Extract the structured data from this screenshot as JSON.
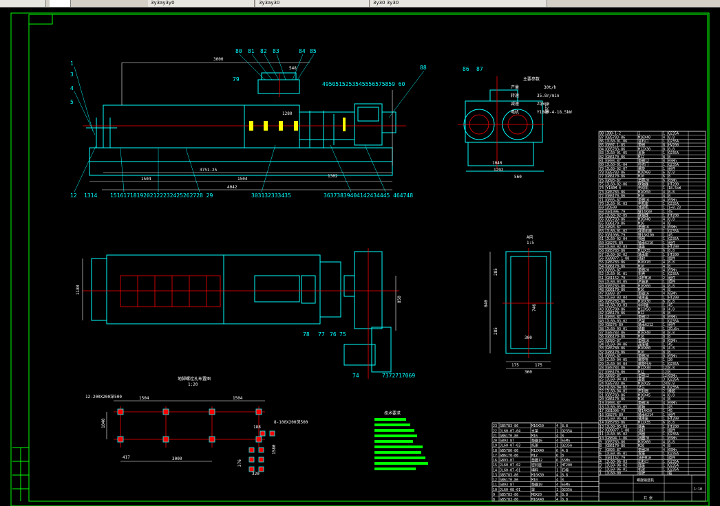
{
  "tabs": [
    {
      "label": "",
      "name": "tab-1"
    },
    {
      "label": "3y3ay3y0",
      "name": "tab-2"
    },
    {
      "label": "3y3ay30",
      "name": "tab-3"
    },
    {
      "label": "3y30 3y30",
      "name": "tab-4"
    },
    {
      "label": "",
      "name": "tab-5"
    }
  ],
  "colors": {
    "background": "#000000",
    "frame": "#00ff00",
    "machine": "#00ffff",
    "centerline": "#ff0000",
    "annotation": "#ffffff",
    "notes": "#00ff00"
  },
  "front_view": {
    "dims": {
      "overall_top": "3000",
      "d548": "548",
      "d3751": "3751.25",
      "d1504a": "1504",
      "d1504b": "1504",
      "d4042": "4042",
      "d1302": "1302",
      "d1280": "1280"
    },
    "callouts_top": [
      "80",
      "81",
      "82",
      "83",
      "84",
      "85",
      "79",
      "88",
      "86",
      "87"
    ],
    "callouts_mid": "4950515253545556575859 60",
    "callouts_left": [
      "1",
      "3",
      "4",
      "5"
    ],
    "callouts_bottom": [
      "12",
      "1314",
      "1516171819202122232425262728 29",
      "303132333435",
      "36373839404142434445 464748"
    ]
  },
  "side_view": {
    "params_title": "主要参数",
    "params": [
      {
        "k": "产量",
        "v": "30t/h"
      },
      {
        "k": "转速",
        "v": "35.8r/min"
      },
      {
        "k": "减速",
        "v": "ZQ500"
      },
      {
        "k": "电机",
        "v": "Y180M-4-18.5kW"
      }
    ],
    "dims": {
      "width1": "1040",
      "width2": "1292",
      "width3": "560"
    }
  },
  "top_view": {
    "callouts": [
      "78",
      "77",
      "76",
      "75",
      "74",
      "7372717069"
    ],
    "dims": {
      "left": "1180",
      "right": "850"
    }
  },
  "section_view": {
    "title": "A向",
    "scale": "1:5",
    "dims": {
      "h_top": "285",
      "h_total": "840",
      "h_bottom": "285",
      "inner": "746",
      "w_inner": "300",
      "w_left": "175",
      "w_right": "175",
      "w_total": "360"
    }
  },
  "foundation": {
    "title": "地脚螺栓孔布置图",
    "scale": "1:20",
    "bolt_label": "12-200X200深500",
    "bolt_label2": "8-100X200深500",
    "dims": {
      "a": "1504",
      "b": "1504",
      "c": "1040",
      "d": "3000",
      "e": "417",
      "f": "188",
      "g": "376",
      "h": "1580",
      "i": "320"
    }
  },
  "notes": {
    "title": "技术要求"
  },
  "parts_table": {
    "rows": [
      "88|JB8-1-2|1|1|Q235A",
      "87|GB5783-86|M16X40|4|8.8",
      "86|JL60-01-06|进料口|1|Q235A",
      "85|GB97.1-85|垫圈|8|HV200",
      "84|GB5783-86|M12X30|8|8.8",
      "83|JL60-01-05|盖板|1|Q235A",
      "82|GB6170-86|M12|8|8",
      "81|GB93-87|垫圈12|8|65Mn",
      "80|JL60-01-04|检修门|1|Q235A",
      "79|JL60-02-07|螺旋|1|组件",
      "78|GB5783-86|M20X60|6|8.8",
      "77|GB6170-86|M20|6|8",
      "76|GB93-87|垫圈20|6|65Mn",
      "75|JL60-02-06|联轴器|1|HT200",
      "74|Y180M-4|电动机|1|18.5kW",
      "73|GB5783-86|M16X50|4|8.8",
      "72|GB6170-86|M16|4|8",
      "71|GB93-87|垫圈16|4|65Mn",
      "70|JL60-01-03|电机座|1|Q235A",
      "69|ZQ500|减速机|1|i=8.23",
      "68|GB1096-79|键14X80|1|45",
      "67|JL60-02-05|联轴器|1|HT200",
      "66|GB5783-86|M16X40|4|8.8",
      "65|GB6170-86|M16|4|8",
      "64|GB93-87|垫圈16|4|65Mn",
      "63|JL60-01-02|减速机座|1|Q235A",
      "62|GB1096-79|键18X100|1|45",
      "61|JL60-02-04|挡圈|1|Q235A",
      "60|GB276-89|轴承6216|1|组件",
      "59|JL60-02-03|端盖|1|HT200",
      "58|GB5783-86|M12X35|6|8.8",
      "57|JL60-02-02|轴承座|1|HT200",
      "56|GB9877.1-88|油封|1|组件",
      "55|GB5783-86|M20X70|4|8.8",
      "54|GB6170-86|M20|4|8",
      "53|GB93-87|垫圈20|4|65Mn",
      "52|JL60-01-01|机壳|1|Q235A",
      "51|GB1152-79|油杯M10|2|组件",
      "50|JL60-03-05|吊轴承|1|组件",
      "49|GB5783-86|M16X60|4|8.8",
      "48|GB6170-86|M16|4|8",
      "47|GB93-87|垫圈16|4|65Mn",
      "46|JL60-03-04|轴承盖|1|HT200",
      "45|GB5783-86|M10X30|6|8.8",
      "44|JL60-03-03|中间轴|1|45",
      "43|GB5780-86|M12X50|8|4.8",
      "42|GB6170-86|M12|8|8",
      "41|GB93-87|垫圈12|8|65Mn",
      "40|JL60-03-02|吊架|1|Q235A",
      "39|GB276-89|轴承6212|1|组件",
      "38|JL60-03-01|轴套|1|ZCuSn",
      "37|GB5783-86|M16X40|8|8.8",
      "36|GB6170-86|M16|8|8",
      "35|GB93-87|垫圈16|8|65Mn",
      "34|JL60-04-06|连接轴|1|45",
      "33|GB5780-86|M20X80|8|4.8",
      "32|GB6170-86|M20|8|8",
      "31|GB93-87|垫圈20|8|65Mn",
      "30|JL60-04-05|螺旋管|1|20",
      "29|JL60-04-04|螺旋叶片|1|Q235A",
      "28|GB5783-86|M12X30|12|8.8",
      "27|GB6170-86|M12|12|8",
      "26|GB93-87|垫圈12|12|65Mn",
      "25|JL60-04-03|盖板|3|Q235A",
      "24|GB5783-86|M10X25|24|8.8",
      "23|JL60-04-02|法兰|4|Q235A",
      "22|JL60-04-01|密封圈|2|橡胶",
      "21|GB5783-86|M16X45|4|8.8",
      "20|GB6170-86|M16|4|8",
      "19|GB93-87|垫圈16|4|65Mn",
      "18|JL60-05-05|尾轴|1|45",
      "17|GB1096-79|键14X50|1|45",
      "16|GB276-89|轴承6214|1|组件",
      "15|JL60-05-04|轴承座|1|HT200",
      "14|GB5783-86|M12X35|6|8.8",
      "13|JL60-05-03|端盖|1|HT200",
      "12|GB9877.1-88|油封|1|组件",
      "11|JL60-05-02|挡圈|1|Q235A",
      "10|GB894.1-86|挡圈70|1|65Mn",
      "9|GB5783-86|M20X60|4|8.8",
      "8|GB6170-86|M20|4|8",
      "7|GB93-87|垫圈20|4|65Mn",
      "6|JL60-05-01|支座|1|Q235A",
      "5|GB1152-79|油杯M10|1|组件",
      "4|JL60-06-03|出料口|1|Q235A",
      "3|JL60-06-02|底座|1|Q235A",
      "2|JL60-06-01|机架|1|Q235A",
      "1|JL60-00|标牌|1|铝"
    ],
    "bottom_rows": [
      "23|GB5783-86|M16X50|4|8.8",
      "22|JL60-07-04|支架|1|Q235A",
      "21|GB6170-86|M16|4|8",
      "20|GB93-87|垫圈16|4|65Mn",
      "19|JL60-07-03|托架|1|Q235A",
      "18|GB5780-86|M12X40|6|4.8",
      "17|GB6170-86|M12|6|8",
      "16|GB93-87|垫圈12|6|65Mn",
      "15|JL60-07-02|密封座|1|HT200",
      "14|JL60-07-01|填料|1|石棉",
      "13|GB5783-86|M10X30|4|8.8",
      "12|GB6170-86|M10|4|8",
      "11|GB93-87|垫圈10|4|65Mn",
      "10|JL60-08-01|罩|1|Q235A",
      "9|GB5783-86|M8X20|8|8.8",
      "8|GB5783-86|M16X40|4|8.8"
    ],
    "title_block": {
      "name": "螺旋输送机",
      "scale": "1:10",
      "sheet": "共 张"
    }
  }
}
